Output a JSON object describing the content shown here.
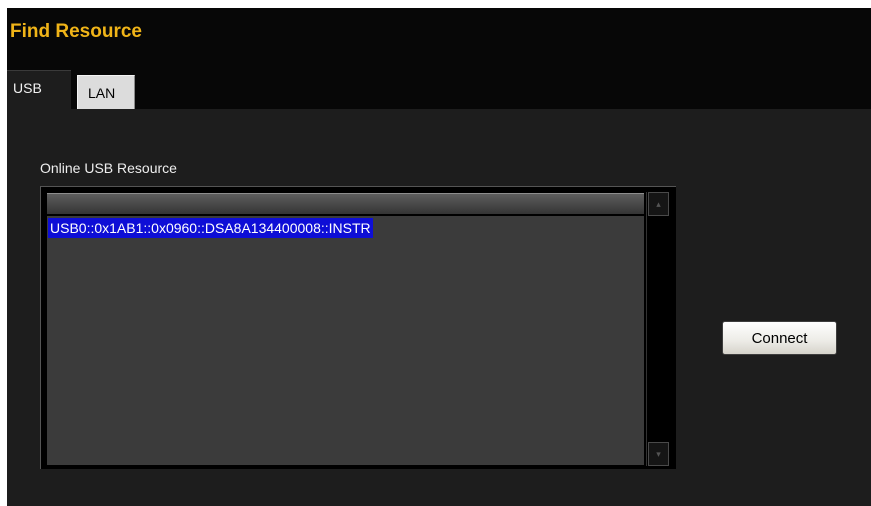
{
  "window": {
    "title": "Find Resource",
    "title_color": "#f0b418"
  },
  "tabs": [
    {
      "label": "USB",
      "selected": true
    },
    {
      "label": "LAN",
      "selected": false
    }
  ],
  "usb_panel": {
    "list_label": "Online USB Resource",
    "resources": [
      {
        "value": "USB0::0x1AB1::0x0960::DSA8A134400008::INSTR",
        "selected": true
      }
    ],
    "selection_color": "#0e0ed6",
    "scroll_up_icon": "▴",
    "scroll_down_icon": "▾"
  },
  "actions": {
    "connect_label": "Connect"
  }
}
